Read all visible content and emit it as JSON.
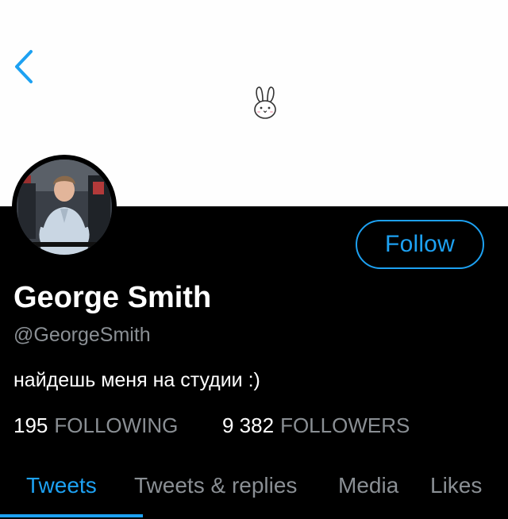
{
  "profile": {
    "name": "George Smith",
    "handle": "@GeorgeSmith",
    "bio": "найдешь меня на студии :)"
  },
  "actions": {
    "follow_label": "Follow"
  },
  "stats": {
    "following": {
      "count": "195",
      "label": "FOLLOWING"
    },
    "followers": {
      "count": "9 382",
      "label": "FOLLOWERS"
    }
  },
  "tabs": [
    {
      "label": "Tweets",
      "active": true
    },
    {
      "label": "Tweets & replies",
      "active": false
    },
    {
      "label": "Media",
      "active": false
    },
    {
      "label": "Likes",
      "active": false
    }
  ],
  "icons": {
    "back": "chevron-left-icon",
    "banner": "bunny-icon"
  },
  "colors": {
    "accent": "#1da1f2",
    "background": "#000000",
    "banner": "#fefefe",
    "secondary_text": "#8a8f94"
  }
}
